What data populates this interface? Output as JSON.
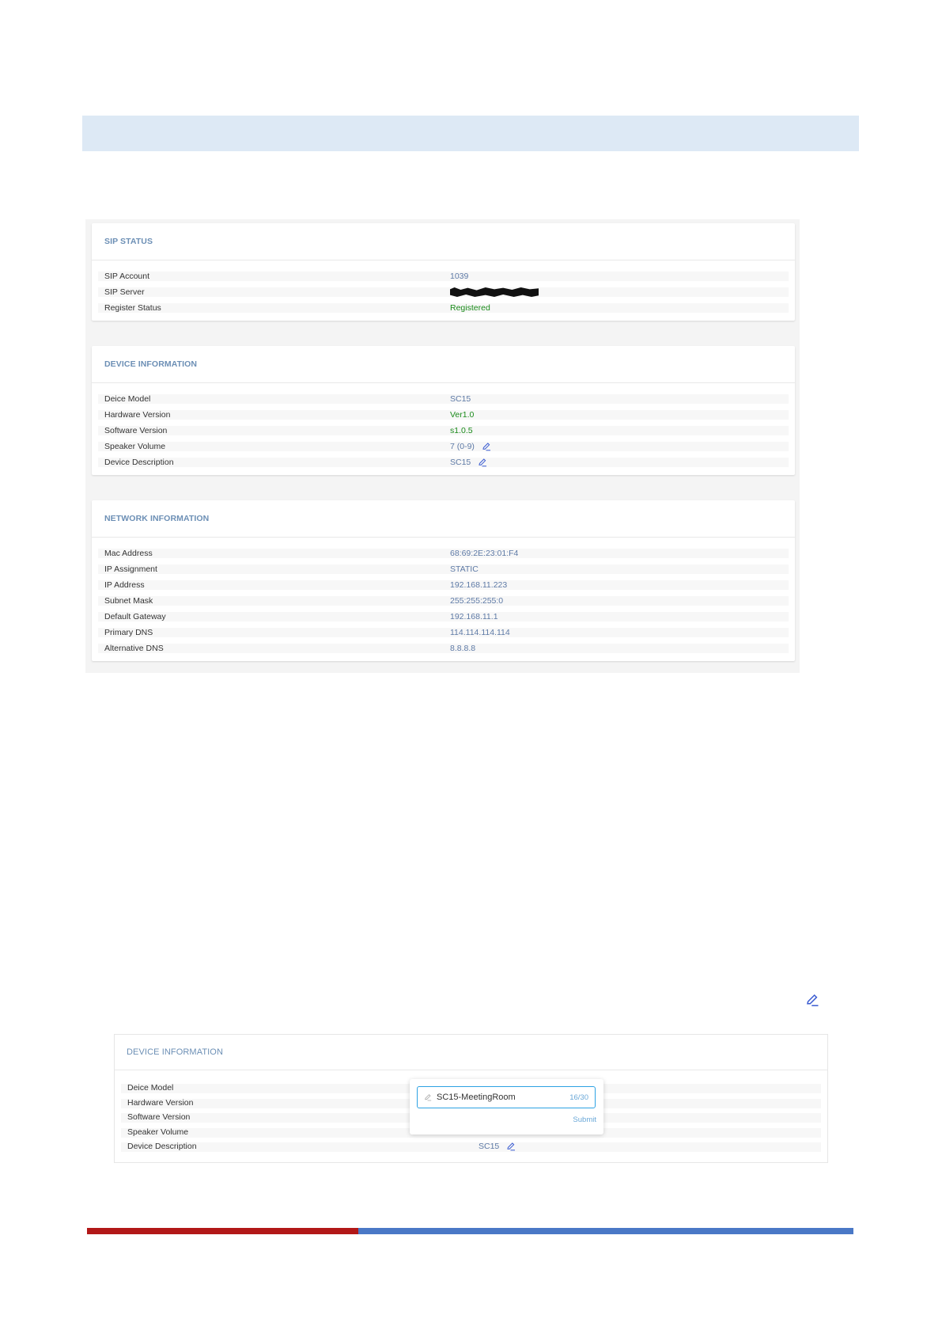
{
  "sip_status": {
    "title": "SIP STATUS",
    "rows": [
      {
        "label": "SIP Account",
        "value": "1039"
      },
      {
        "label": "SIP Server",
        "value": ""
      },
      {
        "label": "Register Status",
        "value": "Registered"
      }
    ]
  },
  "device_info": {
    "title": "DEVICE INFORMATION",
    "rows": [
      {
        "label": "Deice Model",
        "value": "SC15"
      },
      {
        "label": "Hardware Version",
        "value": "Ver1.0"
      },
      {
        "label": "Software Version",
        "value": "s1.0.5"
      },
      {
        "label": "Speaker Volume",
        "value": "7 (0-9)"
      },
      {
        "label": "Device Description",
        "value": "SC15"
      }
    ]
  },
  "network_info": {
    "title": "NETWORK INFORMATION",
    "rows": [
      {
        "label": "Mac Address",
        "value": "68:69:2E:23:01:F4"
      },
      {
        "label": "IP Assignment",
        "value": "STATIC"
      },
      {
        "label": "IP Address",
        "value": "192.168.11.223"
      },
      {
        "label": "Subnet Mask",
        "value": "255:255:255:0"
      },
      {
        "label": "Default Gateway",
        "value": "192.168.11.1"
      },
      {
        "label": "Primary DNS",
        "value": "114.114.114.114"
      },
      {
        "label": "Alternative DNS",
        "value": "8.8.8.8"
      }
    ]
  },
  "edit_example": {
    "title": "DEVICE INFORMATION",
    "rows": [
      {
        "label": "Deice Model"
      },
      {
        "label": "Hardware Version"
      },
      {
        "label": "Software Version"
      },
      {
        "label": "Speaker Volume"
      },
      {
        "label": "Device Description",
        "value": "SC15"
      }
    ],
    "popover": {
      "input_value": "SC15-MeetingRoom",
      "counter": "16/30",
      "submit_label": "Submit"
    }
  },
  "colors": {
    "accent_blue": "#5e7aa6",
    "status_green": "#1a8a1a",
    "bar_red": "#b21818",
    "bar_blue": "#4a78c6"
  },
  "icons": [
    "edit-pencil-icon"
  ]
}
